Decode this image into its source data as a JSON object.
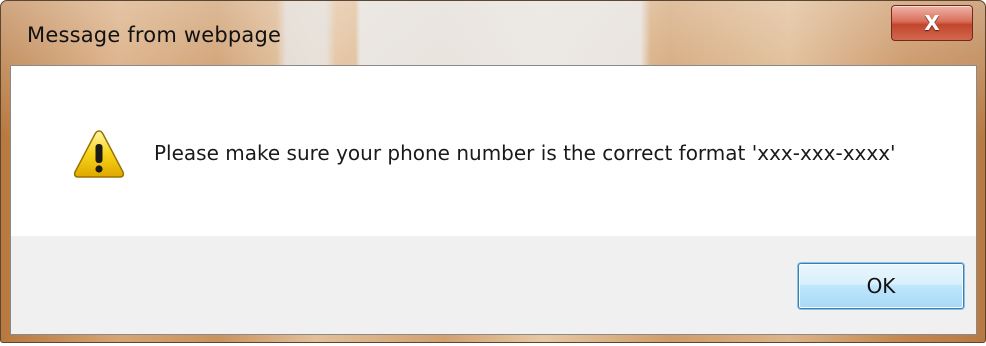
{
  "window": {
    "title": "Message from webpage",
    "close_label": "X"
  },
  "message": {
    "icon": "warning-icon",
    "text": "Please make sure your phone number is the correct format 'xxx-xxx-xxxx'"
  },
  "buttons": {
    "ok_label": "OK"
  },
  "colors": {
    "title_bar_accent": "#c9935f",
    "close_button": "#c2452c",
    "ok_button_border": "#3c7fb1",
    "warning_yellow": "#f5c800"
  }
}
